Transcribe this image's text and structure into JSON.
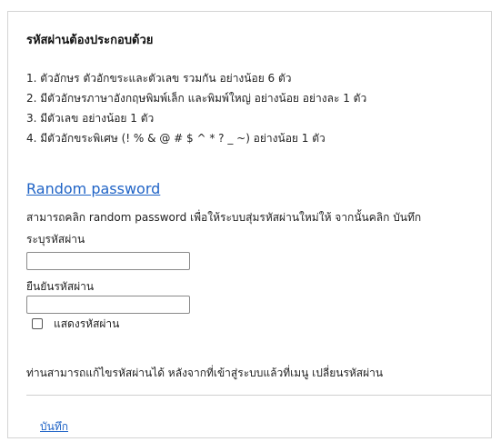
{
  "requirements": {
    "title": "รหัสผ่านต้องประกอบด้วย",
    "items": [
      "1. ตัวอักษร ตัวอักขระและตัวเลข รวมกัน อย่างน้อย 6 ตัว",
      "2. มีตัวอักษรภาษาอังกฤษพิมพ์เล็ก และพิมพ์ใหญ่ อย่างน้อย อย่างละ 1 ตัว",
      "3. มีตัวเลข อย่างน้อย 1 ตัว",
      "4. มีตัวอักขระพิเศษ (! % & @ # $ ^ * ? _ ~) อย่างน้อย 1 ตัว"
    ]
  },
  "random": {
    "link_label": "Random password",
    "description": "สามารถคลิก random password เพื่อให้ระบบสุ่มรหัสผ่านใหม่ให้ จากนั้นคลิก บันทึก"
  },
  "form": {
    "password_label": "ระบุรหัสผ่าน",
    "password_value": "",
    "confirm_label": "ยืนยันรหัสผ่าน",
    "confirm_value": "",
    "show_password_label": "แสดงรหัสผ่าน",
    "show_password_checked": false
  },
  "note": "ท่านสามารถแก้ไขรหัสผ่านได้ หลังจากที่เข้าสู่ระบบแล้วที่เมนู เปลี่ยนรหัสผ่าน",
  "actions": {
    "save_label": "บันทึก"
  },
  "colors": {
    "link": "#1f63c6",
    "border": "#d4d4d4",
    "divider": "#cfcfcf"
  }
}
